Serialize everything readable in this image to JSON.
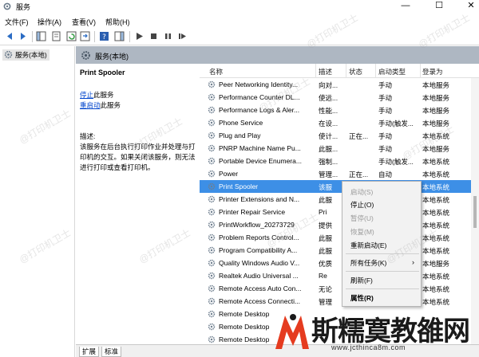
{
  "window": {
    "title": "服务",
    "minimize_icon": "minimize-icon",
    "maximize_icon": "maximize-icon",
    "close_icon": "close-icon",
    "controls": {
      "minimize": "—",
      "maximize": "☐",
      "close": "✕"
    }
  },
  "menu": {
    "file": "文件(F)",
    "action": "操作(A)",
    "view": "查看(V)",
    "help": "帮助(H)"
  },
  "tree": {
    "root_label": "服务(本地)"
  },
  "pane": {
    "header": "服务(本地)"
  },
  "detail": {
    "service_name": "Print Spooler",
    "stop_link": "停止",
    "stop_suffix": "此服务",
    "restart_link": "重启动",
    "restart_suffix": "此服务",
    "desc_label": "描述:",
    "desc_text": "该服务在后台执行打印作业并处理与打印机的交互。如果关闭该服务，则无法进行打印或查看打印机。"
  },
  "columns": {
    "name": "名称",
    "desc": "描述",
    "status": "状态",
    "startup": "启动类型",
    "logon": "登录为"
  },
  "services": [
    {
      "name": "Peer Networking Identity...",
      "desc": "向对...",
      "status": "",
      "startup": "手动",
      "logon": "本地服务"
    },
    {
      "name": "Performance Counter DL...",
      "desc": "使远...",
      "status": "",
      "startup": "手动",
      "logon": "本地服务"
    },
    {
      "name": "Performance Logs & Aler...",
      "desc": "性能...",
      "status": "",
      "startup": "手动",
      "logon": "本地服务"
    },
    {
      "name": "Phone Service",
      "desc": "在设...",
      "status": "",
      "startup": "手动(触发...",
      "logon": "本地服务"
    },
    {
      "name": "Plug and Play",
      "desc": "使计...",
      "status": "正在...",
      "startup": "手动",
      "logon": "本地系统"
    },
    {
      "name": "PNRP Machine Name Pu...",
      "desc": "此服...",
      "status": "",
      "startup": "手动",
      "logon": "本地服务"
    },
    {
      "name": "Portable Device Enumera...",
      "desc": "强制...",
      "status": "",
      "startup": "手动(触发...",
      "logon": "本地系统"
    },
    {
      "name": "Power",
      "desc": "管理...",
      "status": "正在...",
      "startup": "自动",
      "logon": "本地系统"
    },
    {
      "name": "Print Spooler",
      "desc": "该服",
      "status": "",
      "startup": "",
      "logon": "本地系统"
    },
    {
      "name": "Printer Extensions and N...",
      "desc": "此服",
      "status": "",
      "startup": "",
      "logon": "本地系统"
    },
    {
      "name": "Printer Repair Service",
      "desc": "Pri",
      "status": "",
      "startup": "",
      "logon": "本地系统"
    },
    {
      "name": "PrintWorkflow_20273729",
      "desc": "提供",
      "status": "",
      "startup": "",
      "logon": "本地系统"
    },
    {
      "name": "Problem Reports Control...",
      "desc": "此服",
      "status": "",
      "startup": "",
      "logon": "本地系统"
    },
    {
      "name": "Program Compatibility A...",
      "desc": "此服",
      "status": "",
      "startup": "",
      "logon": "本地系统"
    },
    {
      "name": "Quality Windows Audio V...",
      "desc": "优质",
      "status": "",
      "startup": "",
      "logon": "本地服务"
    },
    {
      "name": "Realtek Audio Universal ...",
      "desc": "Re",
      "status": "",
      "startup": "",
      "logon": "本地系统"
    },
    {
      "name": "Remote Access Auto Con...",
      "desc": "无论",
      "status": "",
      "startup": "",
      "logon": "本地系统"
    },
    {
      "name": "Remote Access Connecti...",
      "desc": "管理",
      "status": "",
      "startup": "",
      "logon": "本地系统"
    },
    {
      "name": "Remote Desktop",
      "desc": "",
      "status": "",
      "startup": "",
      "logon": ""
    },
    {
      "name": "Remote Desktop",
      "desc": "",
      "status": "",
      "startup": "",
      "logon": ""
    },
    {
      "name": "Remote Desktop",
      "desc": "",
      "status": "",
      "startup": "",
      "logon": ""
    }
  ],
  "context_menu": {
    "start": "启动(S)",
    "stop": "停止(O)",
    "pause": "暂停(U)",
    "resume": "恢复(M)",
    "restart": "重新启动(E)",
    "all_tasks": "所有任务(K)",
    "all_tasks_arrow": "›",
    "refresh": "刷新(F)",
    "properties": "属性(R)"
  },
  "tabs": {
    "extended": "扩展",
    "standard": "标准"
  },
  "watermark": {
    "text": "@打印机卫士"
  },
  "brand": {
    "name": "斯糯寞教雒网",
    "url": "www.jcthinca8m.com"
  },
  "colors": {
    "selection": "#3d8fe6",
    "pane_header": "#aeb7c2",
    "link": "#0044cc"
  }
}
